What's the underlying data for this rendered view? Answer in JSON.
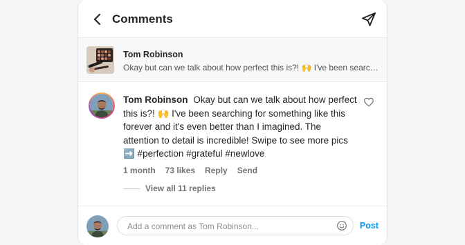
{
  "header": {
    "title": "Comments"
  },
  "post_preview": {
    "username": "Tom Robinson",
    "caption": "Okay but can we talk about how perfect this is?! 🙌 I've been searching for something like this forever and it's even better than I imagined."
  },
  "comment": {
    "username": "Tom Robinson",
    "text": "Okay but can we talk about how perfect this is?! 🙌 I've been searching for something like this forever and it's even better than I imagined. The attention to detail is incredible! Swipe to see more pics ➡️ #perfection #grateful #newlove",
    "time": "1 month",
    "likes": "73 likes",
    "reply_label": "Reply",
    "send_label": "Send",
    "view_replies": "View all 11 replies"
  },
  "composer": {
    "placeholder": "Add a comment as Tom Robinson...",
    "post_label": "Post"
  },
  "colors": {
    "accent": "#0095f6",
    "text": "#262626",
    "muted": "#737373"
  },
  "icons": [
    "chevron-left-icon",
    "send-icon",
    "heart-icon",
    "emoji-icon"
  ]
}
